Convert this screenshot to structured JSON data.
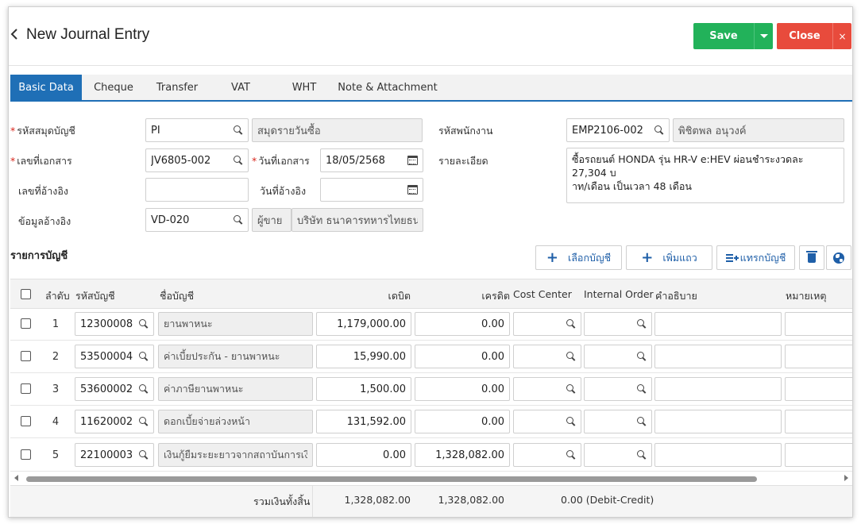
{
  "header": {
    "back_icon": "chevron-left-icon",
    "title": "New Journal Entry",
    "save_label": "Save",
    "close_label": "Close",
    "close_icon": "×"
  },
  "colors": {
    "primary": "#1f6fb6",
    "save": "#22b25a",
    "close": "#e84b3c",
    "required": "#d9261c"
  },
  "tabs": [
    {
      "label": "Basic Data",
      "active": true
    },
    {
      "label": "Cheque"
    },
    {
      "label": "Transfer"
    },
    {
      "label": "VAT"
    },
    {
      "label": "WHT"
    },
    {
      "label": "Note & Attachment"
    }
  ],
  "form": {
    "book_code": {
      "label": "รหัสสมุดบัญชี",
      "value": "PI",
      "name": "สมุดรายวันซื้อ"
    },
    "doc_no": {
      "label": "เลขที่เอกสาร",
      "value": "JV6805-002"
    },
    "doc_date": {
      "label": "วันที่เอกสาร",
      "value": "18/05/2568"
    },
    "ref_no": {
      "label": "เลขที่อ้างอิง",
      "value": ""
    },
    "ref_date": {
      "label": "วันที่อ้างอิง",
      "value": ""
    },
    "ref_info": {
      "label": "ข้อมูลอ้างอิง",
      "value": "VD-020",
      "type": "ผู้ขาย",
      "name": "บริษัท ธนาคารทหารไทยธนชาต"
    },
    "employee": {
      "label": "รหัสพนักงาน",
      "value": "EMP2106-002",
      "name": "พิชิตพล อนุวงค์"
    },
    "detail": {
      "label": "รายละเอียด",
      "line1": "ซื้อรถยนต์ HONDA รุ่น HR-V e:HEV ผ่อนชำระงวดละ 27,304 บ",
      "line2": "าท/เดือน เป็นเวลา 48 เดือน"
    }
  },
  "section": {
    "title": "รายการบัญชี"
  },
  "actions": {
    "select_account": "เลือกบัญชี",
    "add_row": "เพิ่มแถว",
    "insert_account": "แทรกบัญชี",
    "delete_icon": "trash-icon",
    "globe_icon": "globe-icon"
  },
  "grid": {
    "headers": {
      "seq": "ลำดับ",
      "code": "รหัสบัญชี",
      "name": "ชื่อบัญชี",
      "debit": "เดบิต",
      "credit": "เครดิต",
      "cost_center": "Cost Center",
      "internal_order": "Internal Order",
      "description": "คำอธิบาย",
      "remark": "หมายเหตุ"
    },
    "rows": [
      {
        "seq": "1",
        "code": "12300008",
        "name": "ยานพาหนะ",
        "debit": "1,179,000.00",
        "credit": "0.00"
      },
      {
        "seq": "2",
        "code": "53500004",
        "name": "ค่าเบี้ยประกัน - ยานพาหนะ",
        "debit": "15,990.00",
        "credit": "0.00"
      },
      {
        "seq": "3",
        "code": "53600002",
        "name": "ค่าภาษียานพาหนะ",
        "debit": "1,500.00",
        "credit": "0.00"
      },
      {
        "seq": "4",
        "code": "11620002",
        "name": "ดอกเบี้ยจ่ายล่วงหน้า",
        "debit": "131,592.00",
        "credit": "0.00"
      },
      {
        "seq": "5",
        "code": "22100003",
        "name": "เงินกู้ยืมระยะยาวจากสถาบันการเงิน",
        "debit": "0.00",
        "credit": "1,328,082.00"
      }
    ]
  },
  "totals": {
    "label": "รวมเงินทั้งสิ้น",
    "debit": "1,328,082.00",
    "credit": "1,328,082.00",
    "diff": "0.00 (Debit-Credit)"
  }
}
